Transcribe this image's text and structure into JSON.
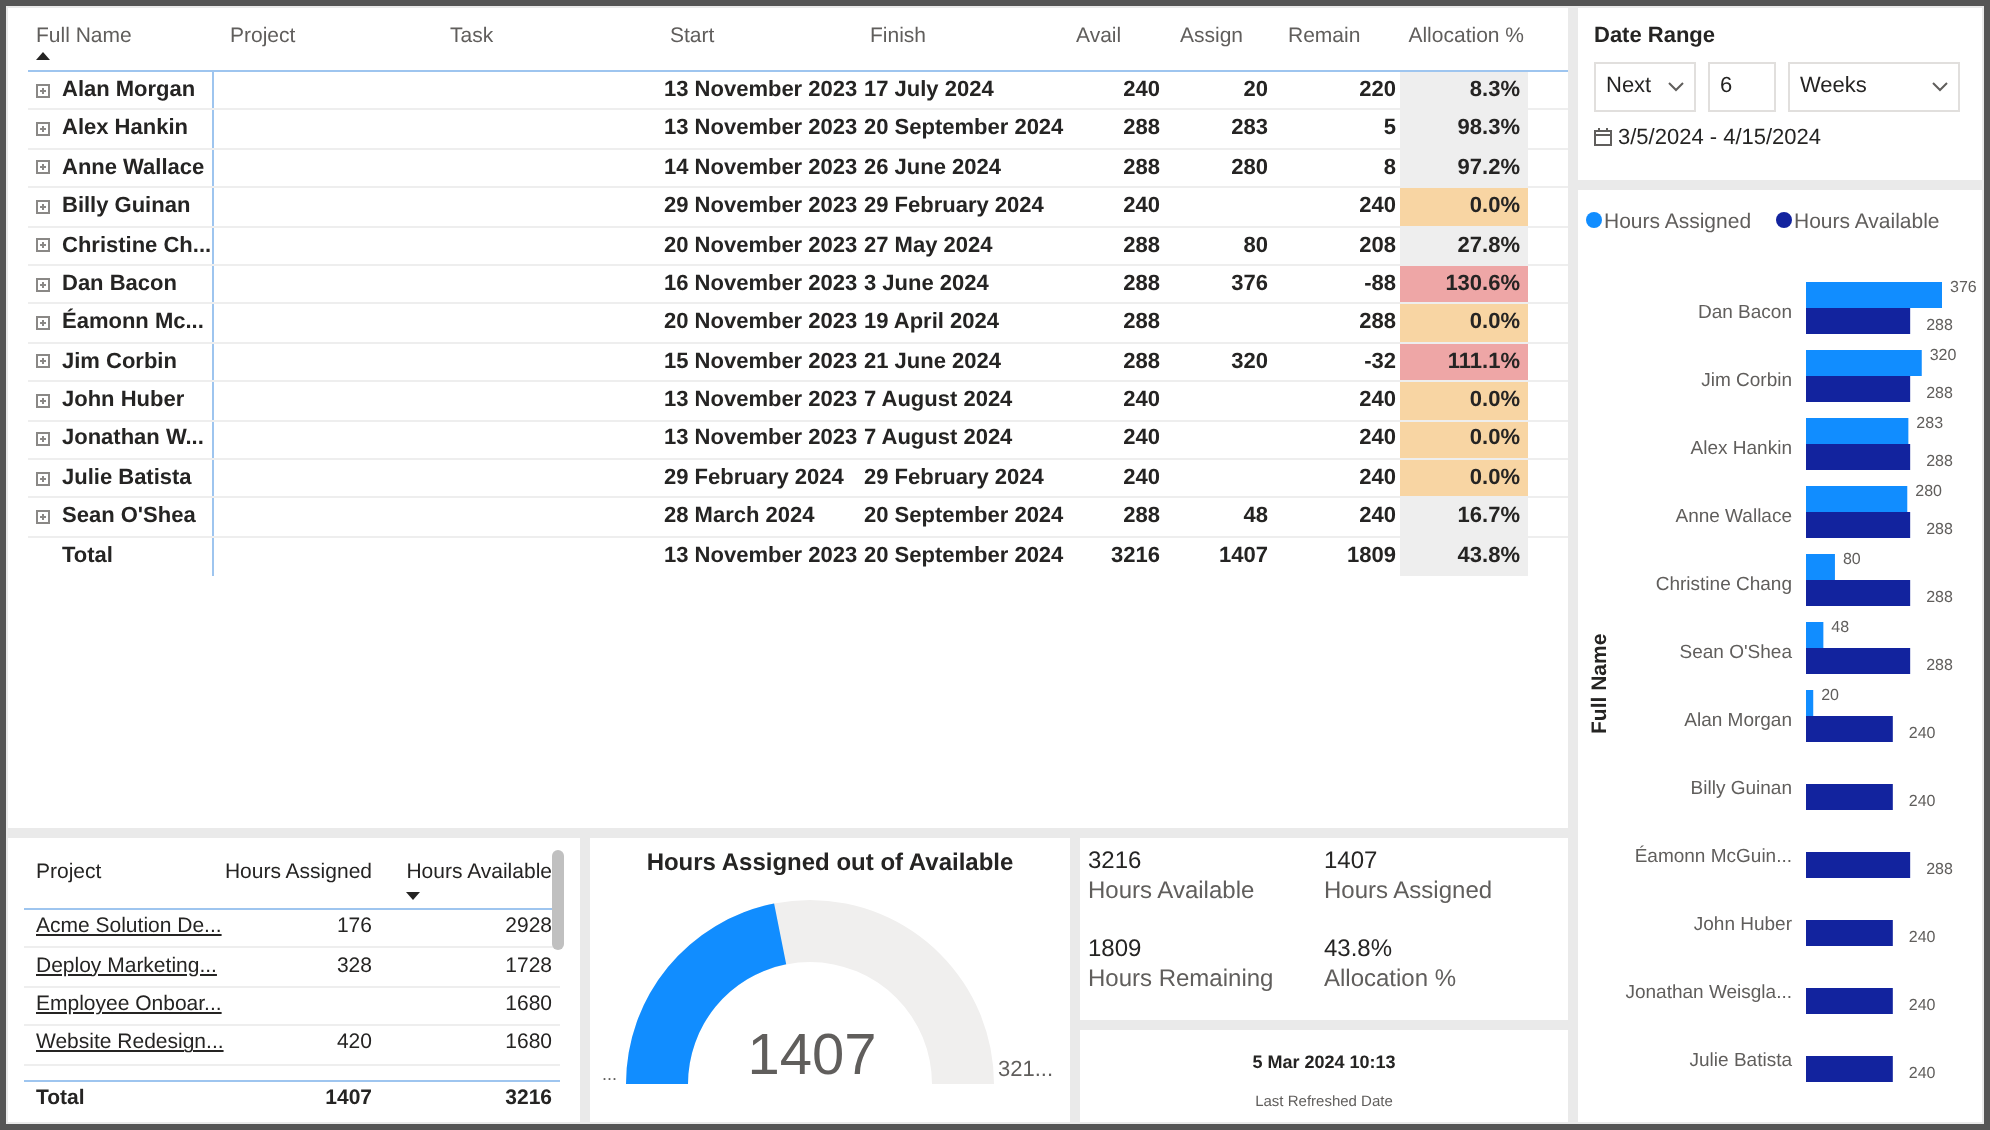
{
  "main_table": {
    "columns": [
      {
        "label": "Full Name",
        "sorted": true,
        "descending": false
      },
      {
        "label": "Project",
        "sorted": false
      },
      {
        "label": "Task",
        "sorted": false
      },
      {
        "label": "Start",
        "sorted": false
      },
      {
        "label": "Finish",
        "sorted": false
      },
      {
        "label": "Avail",
        "sorted": false
      },
      {
        "label": "Assign",
        "sorted": false
      },
      {
        "label": "Remain",
        "sorted": false
      },
      {
        "label": "Allocation %",
        "sorted": false
      }
    ],
    "rows": [
      {
        "name": "Alan Morgan",
        "expanded": false,
        "start": "13 November 2023",
        "finish": "17 July 2024",
        "avail": "240",
        "assign": "20",
        "remain": "220",
        "allocation": "8.3%",
        "color": "#eeeeee"
      },
      {
        "name": "Alex Hankin",
        "expanded": false,
        "start": "13 November 2023",
        "finish": "20 September 2024",
        "avail": "288",
        "assign": "283",
        "remain": "5",
        "allocation": "98.3%",
        "color": "#eeeeee"
      },
      {
        "name": "Anne Wallace",
        "expanded": false,
        "start": "14 November 2023",
        "finish": "26 June 2024",
        "avail": "288",
        "assign": "280",
        "remain": "8",
        "allocation": "97.2%",
        "color": "#eeeeee"
      },
      {
        "name": "Billy Guinan",
        "expanded": false,
        "start": "29 November 2023",
        "finish": "29 February 2024",
        "avail": "240",
        "remain": "240",
        "allocation": "0.0%",
        "color": "#f8d5a3"
      },
      {
        "name": "Christine Ch...",
        "expanded": false,
        "start": "20 November 2023",
        "finish": "27 May 2024",
        "avail": "288",
        "assign": "80",
        "remain": "208",
        "allocation": "27.8%",
        "color": "#eeeeee"
      },
      {
        "name": "Dan Bacon",
        "expanded": false,
        "start": "16 November 2023",
        "finish": "3 June 2024",
        "avail": "288",
        "assign": "376",
        "remain": "-88",
        "allocation": "130.6%",
        "color": "#eea6a6"
      },
      {
        "name": "Éamonn Mc...",
        "expanded": false,
        "start": "20 November 2023",
        "finish": "19 April 2024",
        "avail": "288",
        "remain": "288",
        "allocation": "0.0%",
        "color": "#f8d5a3"
      },
      {
        "name": "Jim Corbin",
        "expanded": false,
        "start": "15 November 2023",
        "finish": "21 June 2024",
        "avail": "288",
        "assign": "320",
        "remain": "-32",
        "allocation": "111.1%",
        "color": "#eea6a6"
      },
      {
        "name": "John Huber",
        "expanded": false,
        "start": "13 November 2023",
        "finish": "7 August 2024",
        "avail": "240",
        "remain": "240",
        "allocation": "0.0%",
        "color": "#f8d5a3"
      },
      {
        "name": "Jonathan W...",
        "expanded": false,
        "start": "13 November 2023",
        "finish": "7 August 2024",
        "avail": "240",
        "remain": "240",
        "allocation": "0.0%",
        "color": "#f8d5a3"
      },
      {
        "name": "Julie Batista",
        "expanded": false,
        "start": "29 February 2024",
        "finish": "29 February 2024",
        "avail": "240",
        "remain": "240",
        "allocation": "0.0%",
        "color": "#f8d5a3"
      },
      {
        "name": "Sean O'Shea",
        "expanded": false,
        "start": "28 March 2024",
        "finish": "20 September 2024",
        "avail": "288",
        "assign": "48",
        "remain": "240",
        "allocation": "16.7%",
        "color": "#eeeeee"
      }
    ],
    "total": {
      "name": "Total",
      "start": "13 November 2023",
      "finish": "20 September 2024",
      "avail": "3216",
      "assign": "1407",
      "remain": "1809",
      "allocation": "43.8%",
      "color": "#eeeeee"
    }
  },
  "date_range": {
    "title": "Date Range",
    "relative": "Next",
    "count": "6",
    "unit": "Weeks",
    "range": "3/5/2024 - 4/15/2024"
  },
  "bar_chart": {
    "chart_data": {
      "type": "bar",
      "orientation": "horizontal",
      "ylabel": "Full Name",
      "categories": [
        "Dan Bacon",
        "Jim Corbin",
        "Alex Hankin",
        "Anne Wallace",
        "Christine Chang",
        "Sean O'Shea",
        "Alan Morgan",
        "Billy Guinan",
        "Éamonn McGuin...",
        "John Huber",
        "Jonathan Weisgla...",
        "Julie Batista"
      ],
      "series": [
        {
          "name": "Hours Assigned",
          "color": "#118dff",
          "values": [
            376,
            320,
            283,
            280,
            80,
            48,
            20,
            null,
            null,
            null,
            null,
            null
          ]
        },
        {
          "name": "Hours Available",
          "color": "#12239e",
          "values": [
            288,
            288,
            288,
            288,
            288,
            288,
            240,
            240,
            288,
            240,
            240,
            240
          ]
        }
      ],
      "legend": "top",
      "data_labels": true
    }
  },
  "project_table": {
    "columns": [
      {
        "label": "Project",
        "sorted": false
      },
      {
        "label": "Hours Assigned",
        "sorted": false
      },
      {
        "label": "Hours Available",
        "sorted": true,
        "descending": true
      }
    ],
    "rows": [
      {
        "project": "Acme Solution De...",
        "assigned": "176",
        "available": "2928"
      },
      {
        "project": "Deploy Marketing...",
        "assigned": "328",
        "available": "1728"
      },
      {
        "project": "Employee Onboar...",
        "available": "1680"
      },
      {
        "project": "Website Redesign...",
        "assigned": "420",
        "available": "1680"
      }
    ],
    "total": {
      "label": "Total",
      "assigned": "1407",
      "available": "3216"
    }
  },
  "gauge": {
    "title": "Hours Assigned out of Available",
    "value": "1407",
    "min_label": "...",
    "max_label": "321..."
  },
  "kpis": [
    {
      "value": "3216",
      "label": "Hours Available"
    },
    {
      "value": "1407",
      "label": "Hours Assigned"
    },
    {
      "value": "1809",
      "label": "Hours Remaining"
    },
    {
      "value": "43.8%",
      "label": "Allocation %"
    }
  ],
  "refresh": {
    "value": "5 Mar 2024 10:13",
    "label": "Last Refreshed Date"
  }
}
